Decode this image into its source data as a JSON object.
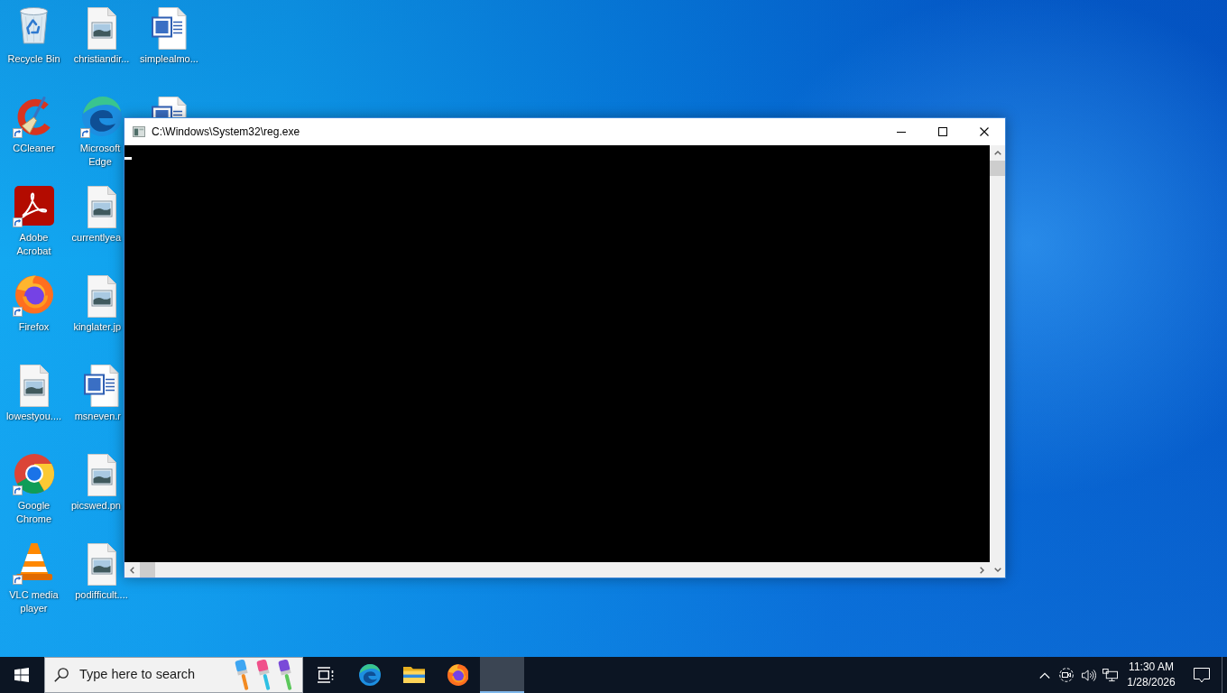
{
  "desktop_icons": [
    {
      "label": "Recycle Bin",
      "kind": "recycle-bin",
      "shortcut": false
    },
    {
      "label": "CCleaner",
      "kind": "ccleaner",
      "shortcut": true
    },
    {
      "label": "Adobe Acrobat",
      "kind": "acrobat",
      "shortcut": true
    },
    {
      "label": "Firefox",
      "kind": "firefox",
      "shortcut": true
    },
    {
      "label": "lowestyou....",
      "kind": "image-file",
      "shortcut": false
    },
    {
      "label": "Google Chrome",
      "kind": "chrome",
      "shortcut": true
    },
    {
      "label": "VLC media player",
      "kind": "vlc",
      "shortcut": true
    },
    {
      "label": "christiandir...",
      "kind": "image-file",
      "shortcut": false
    },
    {
      "label": "Microsoft Edge",
      "kind": "edge",
      "shortcut": true
    },
    {
      "label": "currentlyea",
      "kind": "image-file",
      "shortcut": false
    },
    {
      "label": "kinglater.jp",
      "kind": "image-file",
      "shortcut": false
    },
    {
      "label": "msneven.r",
      "kind": "word-file",
      "shortcut": false
    },
    {
      "label": "picswed.pn",
      "kind": "image-file",
      "shortcut": false
    },
    {
      "label": "podifficult....",
      "kind": "image-file",
      "shortcut": false
    },
    {
      "label": "simplealmo...",
      "kind": "word-file",
      "shortcut": false
    },
    {
      "kind": "word-file",
      "shortcut": false
    }
  ],
  "window": {
    "title": "C:\\Windows\\System32\\reg.exe"
  },
  "taskbar": {
    "search": {
      "placeholder": "Type here to search"
    },
    "apps": [
      {
        "kind": "edge",
        "selected": false
      },
      {
        "kind": "explorer",
        "selected": false
      },
      {
        "kind": "firefox",
        "selected": false
      },
      {
        "kind": "console",
        "selected": true
      }
    ],
    "clock": {
      "time": "11:30 AM",
      "date": "1/28/2026"
    }
  }
}
